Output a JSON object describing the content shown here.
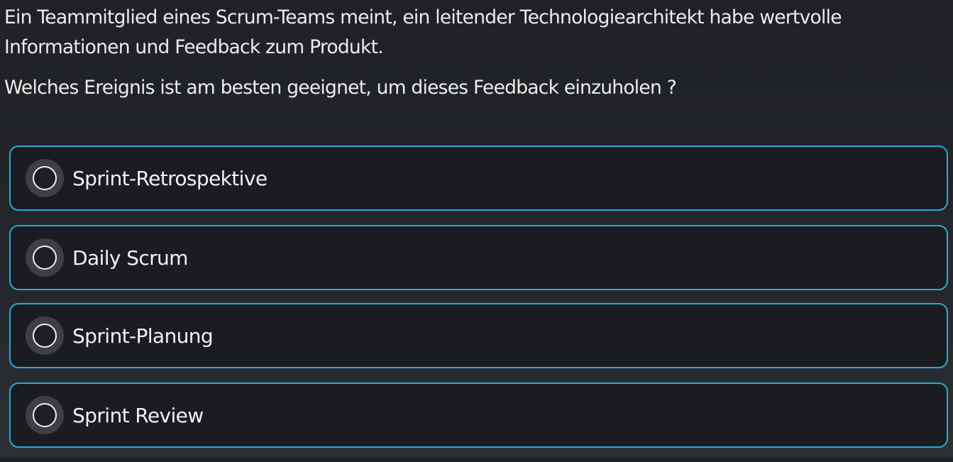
{
  "question": {
    "line1": "Ein Teammitglied eines Scrum-Teams meint, ein leitender Technologiearchitekt habe wertvolle",
    "line2": "Informationen und Feedback zum Produkt.",
    "prompt": "Welches Ereignis ist am besten geeignet, um dieses Feedback einzuholen ?"
  },
  "options": [
    {
      "label": "Sprint-Retrospektive"
    },
    {
      "label": "Daily Scrum"
    },
    {
      "label": "Sprint-Planung"
    },
    {
      "label": "Sprint Review"
    }
  ],
  "colors": {
    "accent_border": "#2aa8dd",
    "option_background": "#1a1c1f",
    "radio_ring": "#3d3f43"
  }
}
